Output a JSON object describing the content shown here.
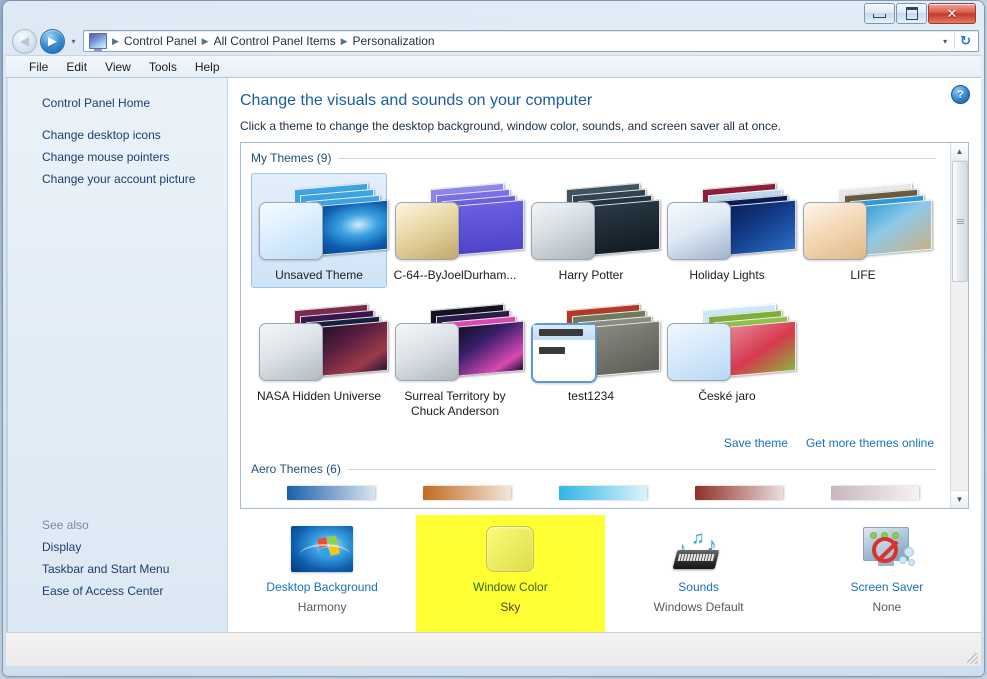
{
  "window": {
    "caption_buttons": {
      "minimize": "–",
      "maximize": "□",
      "close": "✕"
    }
  },
  "addressbar": {
    "back_glyph": "◀",
    "forward_glyph": "▶",
    "history_glyph": "▾",
    "crumbs": [
      "Control Panel",
      "All Control Panel Items",
      "Personalization"
    ],
    "separator": "▶",
    "dropdown_glyph": "▾",
    "refresh_glyph": "↻"
  },
  "menubar": {
    "items": [
      "File",
      "Edit",
      "View",
      "Tools",
      "Help"
    ]
  },
  "sidebar": {
    "home": "Control Panel Home",
    "tasks": [
      "Change desktop icons",
      "Change mouse pointers",
      "Change your account picture"
    ],
    "see_also_title": "See also",
    "see_also": [
      "Display",
      "Taskbar and Start Menu",
      "Ease of Access Center"
    ]
  },
  "main": {
    "help_glyph": "?",
    "title": "Change the visuals and sounds on your computer",
    "subtitle": "Click a theme to change the desktop background, window color, sounds, and screen saver all at once."
  },
  "gallery": {
    "my_themes_label": "My Themes (9)",
    "aero_themes_label": "Aero Themes (6)",
    "save_theme": "Save theme",
    "get_more_themes": "Get more themes online",
    "scroll_up_glyph": "▲",
    "scroll_down_glyph": "▼",
    "my_themes": [
      {
        "label": "Unsaved Theme",
        "selected": true,
        "preview": "radial-gradient(ellipse at 62% 45%,#cfeafc 0%,#3da3e2 28%,#0d5fb2 62%,#063a79 100%)",
        "win": "linear-gradient(155deg,#f4fbff 0%,#dcefff 45%,#bcdcf5 100%)",
        "stack": [
          "#3da3e2",
          "#3da3e2",
          "#3da3e2",
          "#0d5fb2"
        ]
      },
      {
        "label": "C-64--ByJoelDurham...",
        "selected": false,
        "preview": "linear-gradient(180deg,#6b5fe0 0%,#4f43c8 100%)",
        "win": "linear-gradient(155deg,#fdf6e2 0%,#e8d7a5 45%,#c3a96a 100%)",
        "stack": [
          "#8e86ea",
          "#7a70e6",
          "#6b5fe0",
          "#5247cc"
        ]
      },
      {
        "label": "Harry Potter",
        "selected": false,
        "preview": "linear-gradient(170deg,#2a3a46 0%,#101a22 100%)",
        "win": "linear-gradient(155deg,#f3f6f8 0%,#d6dde2 45%,#aab4bb 100%)",
        "stack": [
          "#40535f",
          "#2f4350",
          "#223440",
          "#101a22"
        ]
      },
      {
        "label": "Holiday Lights",
        "selected": false,
        "preview": "linear-gradient(150deg,#0a1c52 0%,#123a86 45%,#2a6ec4 100%)",
        "win": "linear-gradient(155deg,#f7fbff 0%,#dfeaf6 45%,#9fb2cc 100%)",
        "stack": [
          "#8c1f3a",
          "#bfd8ec",
          "#0a1c52",
          "#123a86"
        ]
      },
      {
        "label": "LIFE",
        "selected": false,
        "preview": "linear-gradient(150deg,#2f9ad6 0%,#8ec9e8 45%,#c8b187 100%)",
        "win": "linear-gradient(155deg,#fff6ec 0%,#f4d9b8 45%,#e0b887 100%)",
        "stack": [
          "#e8e8e8",
          "#6b5a3c",
          "#2f9ad6",
          "#d8b274"
        ]
      }
    ],
    "my_themes_row2": [
      {
        "label": "NASA Hidden Universe",
        "selected": false,
        "preview": "linear-gradient(150deg,#1a0d2a 0%,#5a1f3f 40%,#9c3a4a 75%,#2d1638 100%)",
        "win": "linear-gradient(155deg,#f4f6f8 0%,#dde3e8 45%,#b0bac2 100%)",
        "stack": [
          "#7b2a4a",
          "#3a1550",
          "#14203f",
          "#5a2440"
        ]
      },
      {
        "label": "Surreal Territory by Chuck Anderson",
        "selected": false,
        "preview": "linear-gradient(150deg,#0d0d16 0%,#3a1f6e 40%,#d84ab0 80%,#1a1030 100%)",
        "win": "linear-gradient(155deg,#f5f7f9 0%,#dde2e7 45%,#aeb8c0 100%)",
        "stack": [
          "#13131f",
          "#2a1b4a",
          "#d84ab0",
          "#1a1030"
        ]
      },
      {
        "label": "test1234",
        "selected": false,
        "preview": "linear-gradient(160deg,#8b8b84 0%,#5c5c55 100%)",
        "win": "linear-gradient(155deg,#eef5fb 0%,#dce9f5 100%)",
        "stack": [
          "#b03a2a",
          "#6f7a5e",
          "#8b8b84",
          "#5c5c55"
        ],
        "special": "rss-window"
      },
      {
        "label": "České jaro",
        "selected": false,
        "preview": "linear-gradient(150deg,#e88a9c 0%,#d6394f 55%,#8ab33a 100%)",
        "win": "linear-gradient(155deg,#f0f8ff 0%,#d8eafb 45%,#b7d8f2 100%)",
        "stack": [
          "#cfe6f5",
          "#7fae3f",
          "#8fc24a",
          "#d6394f"
        ]
      }
    ],
    "aero_strips": [
      "#1c5fa8",
      "#c06a20",
      "#2fb6e6",
      "#8e2f2a",
      "#c9b5bf"
    ]
  },
  "settings": [
    {
      "name": "Desktop Background",
      "value": "Harmony",
      "icon": "wallpaper-icon",
      "highlight": false
    },
    {
      "name": "Window Color",
      "value": "Sky",
      "icon": "window-color-icon",
      "highlight": true
    },
    {
      "name": "Sounds",
      "value": "Windows Default",
      "icon": "sounds-icon",
      "highlight": false
    },
    {
      "name": "Screen Saver",
      "value": "None",
      "icon": "screen-saver-icon",
      "highlight": false
    }
  ]
}
